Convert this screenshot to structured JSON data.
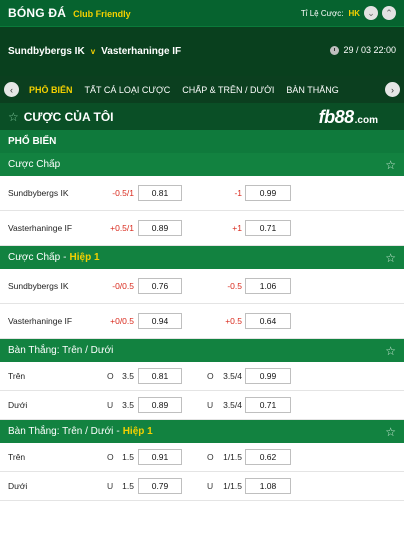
{
  "header": {
    "title": "BÓNG ĐÁ",
    "subtitle": "Club Friendly",
    "odds_label": "Tỉ Lệ Cược:",
    "odds_value": "HK"
  },
  "match": {
    "home": "Sundbybergs IK",
    "vs": "v",
    "away": "Vasterhaninge IF",
    "datetime": "29 / 03  22:00"
  },
  "tabs": [
    "PHỔ BIẾN",
    "TẤT CẢ LOẠI CƯỢC",
    "CHẤP & TRÊN / DƯỚI",
    "BÀN THẮNG"
  ],
  "bets_bar": {
    "label": "CƯỢC CỦA TÔI",
    "logo_main": "fb88",
    "logo_domain": ".com"
  },
  "section_title": "PHỔ BIẾN",
  "markets": [
    {
      "title": "Cược Chấp",
      "highlight": "",
      "rows": [
        {
          "team": "Sundbybergs IK",
          "h1": "-0.5/1",
          "o1": "0.81",
          "h2": "-1",
          "o2": "0.99"
        },
        {
          "team": "Vasterhaninge IF",
          "h1": "+0.5/1",
          "o1": "0.89",
          "h2": "+1",
          "o2": "0.71"
        }
      ]
    },
    {
      "title": "Cược Chấp",
      "highlight": "Hiệp 1",
      "rows": [
        {
          "team": "Sundbybergs IK",
          "h1": "-0/0.5",
          "o1": "0.76",
          "h2": "-0.5",
          "o2": "1.06"
        },
        {
          "team": "Vasterhaninge IF",
          "h1": "+0/0.5",
          "o1": "0.94",
          "h2": "+0.5",
          "o2": "0.64"
        }
      ]
    },
    {
      "title": "Bàn Thắng: Trên / Dưới",
      "highlight": "",
      "rows": [
        {
          "team": "Trên",
          "ou1": "O",
          "h1": "3.5",
          "o1": "0.81",
          "ou2": "O",
          "h2": "3.5/4",
          "o2": "0.99"
        },
        {
          "team": "Dưới",
          "ou1": "U",
          "h1": "3.5",
          "o1": "0.89",
          "ou2": "U",
          "h2": "3.5/4",
          "o2": "0.71"
        }
      ]
    },
    {
      "title": "Bàn Thắng: Trên / Dưới",
      "highlight": "Hiệp 1",
      "rows": [
        {
          "team": "Trên",
          "ou1": "O",
          "h1": "1.5",
          "o1": "0.91",
          "ou2": "O",
          "h2": "1/1.5",
          "o2": "0.62"
        },
        {
          "team": "Dưới",
          "ou1": "U",
          "h1": "1.5",
          "o1": "0.79",
          "ou2": "U",
          "h2": "1/1.5",
          "o2": "1.08"
        }
      ]
    }
  ],
  "colors": {
    "brand_green": "#06632f",
    "dark_green": "#09401e",
    "accent_yellow": "#f5d100",
    "handicap_red": "#d9291c"
  }
}
